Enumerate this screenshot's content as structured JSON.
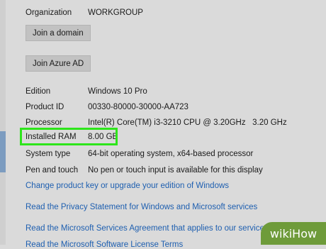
{
  "organization": {
    "label": "Organization",
    "value": "WORKGROUP"
  },
  "buttons": {
    "join_domain": "Join a domain",
    "join_azure": "Join Azure AD"
  },
  "specs": [
    {
      "label": "Edition",
      "value": "Windows 10 Pro"
    },
    {
      "label": "Product ID",
      "value": "00330-80000-30000-AA723"
    },
    {
      "label": "Processor",
      "value": "Intel(R) Core(TM) i3-3210 CPU @ 3.20GHz   3.20 GHz"
    },
    {
      "label": "Installed RAM",
      "value": "8.00 GB"
    },
    {
      "label": "System type",
      "value": "64-bit operating system, x64-based processor"
    },
    {
      "label": "Pen and touch",
      "value": "No pen or touch input is available for this display"
    }
  ],
  "links": [
    "Change product key or upgrade your edition of Windows",
    "Read the Privacy Statement for Windows and Microsoft services",
    "Read the Microsoft Services Agreement that applies to our services",
    "Read the Microsoft Software License Terms"
  ],
  "watermark": {
    "text": "wikiHow"
  },
  "colors": {
    "background": "#dadada",
    "link": "#1e5fb0",
    "highlight": "#2ee51b",
    "watermark": "#6e9b3a"
  }
}
